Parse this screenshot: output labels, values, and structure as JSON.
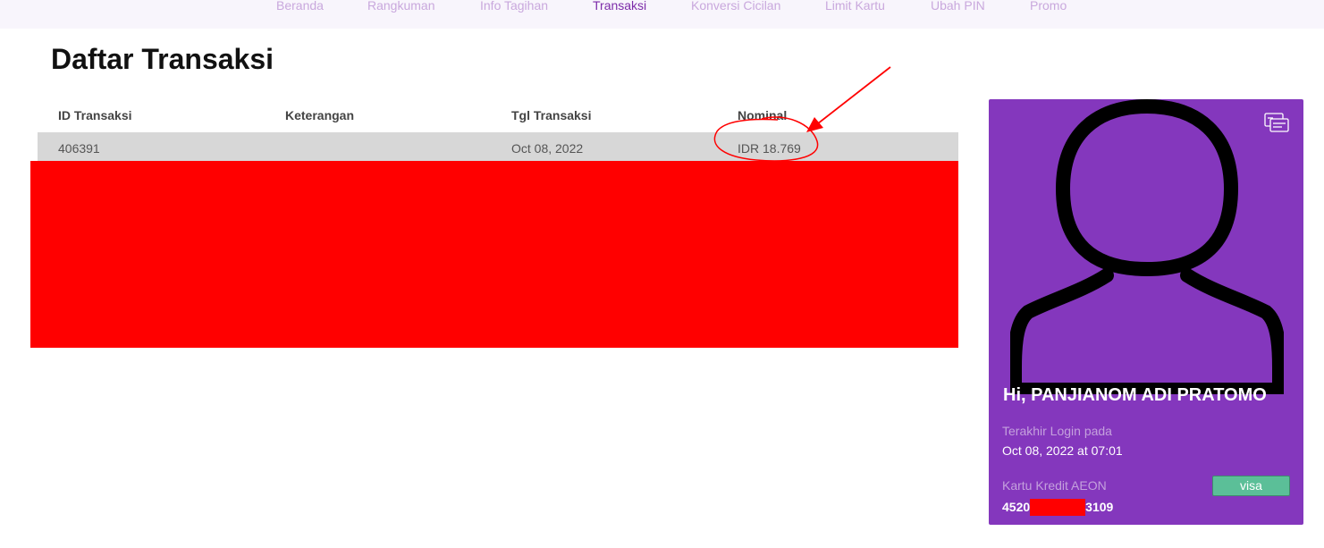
{
  "nav": {
    "items": [
      "Beranda",
      "Rangkuman",
      "Info Tagihan",
      "Transaksi",
      "Konversi Cicilan",
      "Limit Kartu",
      "Ubah PIN",
      "Promo"
    ],
    "active_index": 3
  },
  "page": {
    "title": "Daftar Transaksi"
  },
  "table": {
    "headers": [
      "ID Transaksi",
      "Keterangan",
      "Tgl Transaksi",
      "Nominal"
    ],
    "rows": [
      {
        "id": "406391",
        "description": "",
        "date": "Oct 08, 2022",
        "amount": "IDR 18.769"
      }
    ]
  },
  "profile": {
    "greeting": "Hi, PANJIANOM ADI PRATOMO",
    "last_login_label": "Terakhir Login pada",
    "last_login_value": "Oct 08, 2022 at 07:01",
    "card_type_label": "Kartu Kredit AEON",
    "card_brand_button": "visa",
    "card_number_start": "4520",
    "card_number_end": "3109"
  },
  "colors": {
    "accent": "#8437bd",
    "nav_active": "#7d2ca9",
    "nav_inactive": "#c9a8dd",
    "redaction": "#ff0000",
    "visa_button": "#5bbf98",
    "row_highlight": "#d7d7d7"
  },
  "icons": {
    "card_icon": "credit-card-icon",
    "avatar": "user-avatar-icon"
  }
}
